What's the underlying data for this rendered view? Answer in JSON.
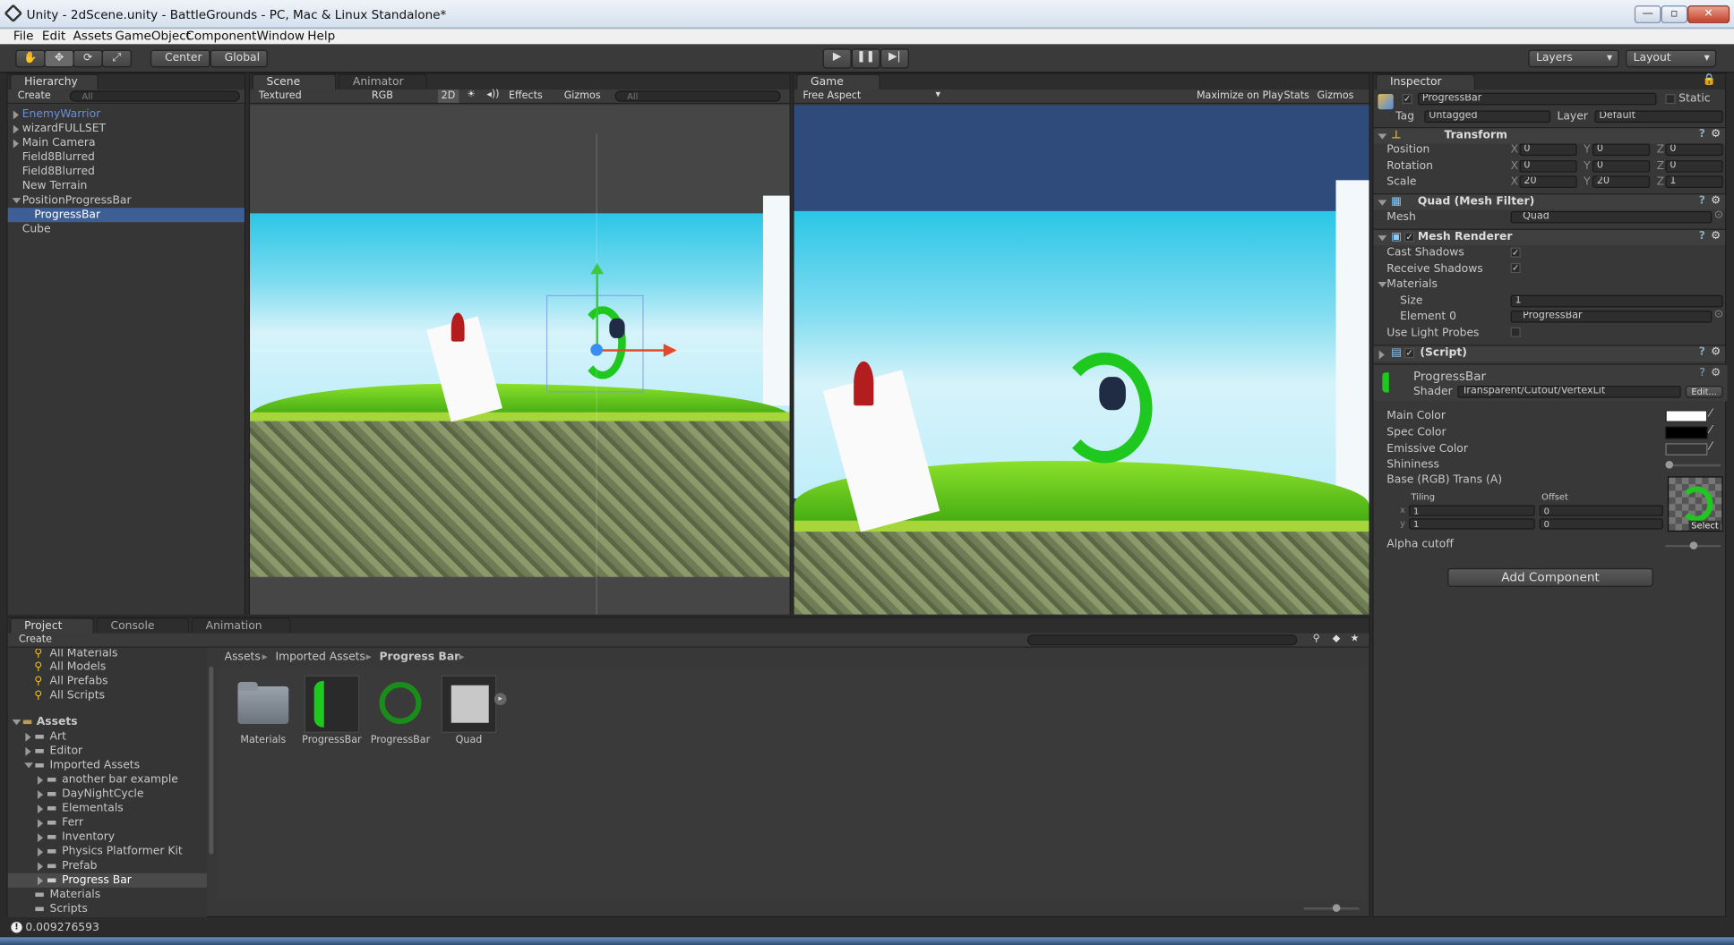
{
  "window": {
    "title": "Unity - 2dScene.unity - BattleGrounds - PC, Mac & Linux Standalone*"
  },
  "menu": [
    "File",
    "Edit",
    "Assets",
    "GameObject",
    "Component",
    "Window",
    "Help"
  ],
  "toolbar": {
    "pivot": "Center",
    "space": "Global",
    "layers": "Layers",
    "layout": "Layout"
  },
  "hierarchy": {
    "tab": "Hierarchy",
    "create": "Create",
    "items": [
      "EnemyWarrior",
      "wizardFULLSET",
      "Main Camera",
      "Field8Blurred",
      "Field8Blurred",
      "New Terrain",
      "PositionProgressBar",
      "ProgressBar",
      "Cube"
    ]
  },
  "scene": {
    "tabs": [
      "Scene",
      "Animator"
    ],
    "shading": "Textured",
    "render": "RGB",
    "mode2d": "2D",
    "effects": "Effects",
    "gizmos": "Gizmos",
    "search": "All"
  },
  "game": {
    "tab": "Game",
    "aspect": "Free Aspect",
    "maximize": "Maximize on Play",
    "stats": "Stats",
    "gizmos": "Gizmos"
  },
  "inspector": {
    "tab": "Inspector",
    "object_name": "ProgressBar",
    "static_label": "Static",
    "tag_label": "Tag",
    "tag": "Untagged",
    "layer_label": "Layer",
    "layer": "Default",
    "transform": {
      "title": "Transform",
      "position": {
        "label": "Position",
        "x": "0",
        "y": "0",
        "z": "0"
      },
      "rotation": {
        "label": "Rotation",
        "x": "0",
        "y": "0",
        "z": "0"
      },
      "scale": {
        "label": "Scale",
        "x": "20",
        "y": "20",
        "z": "1"
      }
    },
    "mesh_filter": {
      "title": "Quad (Mesh Filter)",
      "mesh_label": "Mesh",
      "mesh": "Quad"
    },
    "mesh_renderer": {
      "title": "Mesh Renderer",
      "cast_shadows": "Cast Shadows",
      "receive_shadows": "Receive Shadows",
      "materials": "Materials",
      "size_label": "Size",
      "size": "1",
      "element0_label": "Element 0",
      "element0": "ProgressBar",
      "light_probes": "Use Light Probes"
    },
    "script": {
      "title": "(Script)"
    },
    "material": {
      "name": "ProgressBar",
      "shader_label": "Shader",
      "shader": "Transparent/Cutout/VertexLit",
      "edit": "Edit...",
      "main_color": "Main Color",
      "spec_color": "Spec Color",
      "emissive_color": "Emissive Color",
      "shininess": "Shininess",
      "base": "Base (RGB) Trans (A)",
      "tiling": "Tiling",
      "offset": "Offset",
      "tiling_x": "1",
      "tiling_y": "1",
      "offset_x": "0",
      "offset_y": "0",
      "select": "Select",
      "alpha_cutoff": "Alpha cutoff"
    },
    "add_component": "Add Component"
  },
  "project": {
    "tabs": [
      "Project",
      "Console",
      "Animation"
    ],
    "create": "Create",
    "favorites": [
      "All Materials",
      "All Models",
      "All Prefabs",
      "All Scripts"
    ],
    "root": "Assets",
    "tree": [
      "Art",
      "Editor",
      "Imported Assets",
      "another bar example",
      "DayNightCycle",
      "Elementals",
      "Ferr",
      "Inventory",
      "Physics Platformer Kit",
      "Prefab",
      "Progress Bar",
      "Materials",
      "Scripts"
    ],
    "breadcrumb": [
      "Assets",
      "Imported Assets",
      "Progress Bar"
    ],
    "assets": [
      "Materials",
      "ProgressBar",
      "ProgressBar",
      "Quad"
    ]
  },
  "status": {
    "message": "0.009276593"
  },
  "colors": {
    "accent": "#3e5f96",
    "ring": "#1ec81e",
    "sky": "#2bc6e6",
    "grass": "#55c81a",
    "game_bg": "#2f4b7c"
  }
}
